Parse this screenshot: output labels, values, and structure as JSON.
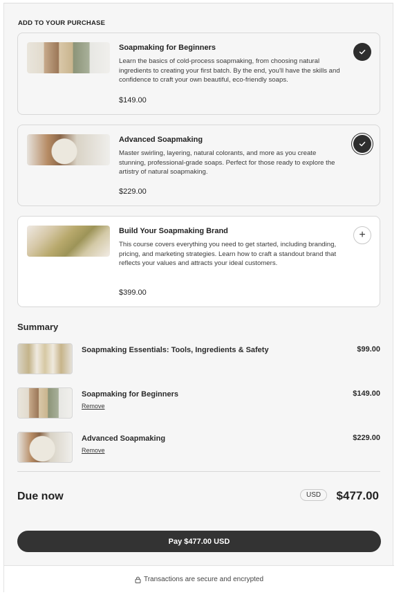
{
  "upsell": {
    "heading": "ADD TO YOUR PURCHASE",
    "items": [
      {
        "title": "Soapmaking for Beginners",
        "description": "Learn the basics of cold-process soapmaking, from choosing natural ingredients to creating your first batch. By the end, you'll have the skills and confidence to craft your own beautiful, eco-friendly soaps.",
        "price": "$149.00",
        "selected": true,
        "icon": "check-icon"
      },
      {
        "title": "Advanced Soapmaking",
        "description": "Master swirling, layering, natural colorants, and more as you create stunning, professional-grade soaps. Perfect for those ready to explore the artistry of natural soapmaking.",
        "price": "$229.00",
        "selected": true,
        "icon": "check-icon"
      },
      {
        "title": "Build Your Soapmaking Brand",
        "description": "This course covers everything you need to get started, including branding, pricing, and marketing strategies. Learn how to craft a standout brand that reflects your values and attracts your ideal customers.",
        "price": "$399.00",
        "selected": false,
        "icon": "plus-icon",
        "action_glyph": "+"
      }
    ]
  },
  "summary": {
    "heading": "Summary",
    "rows": [
      {
        "name": "Soapmaking Essentials: Tools, Ingredients & Safety",
        "amount": "$99.00",
        "removable": false
      },
      {
        "name": "Soapmaking for Beginners",
        "amount": "$149.00",
        "removable": true,
        "remove_label": "Remove"
      },
      {
        "name": "Advanced Soapmaking",
        "amount": "$229.00",
        "removable": true,
        "remove_label": "Remove"
      }
    ]
  },
  "due": {
    "label": "Due now",
    "currency": "USD",
    "total": "$477.00"
  },
  "pay_button": {
    "label": "Pay $477.00 USD"
  },
  "footer": {
    "text": "Transactions are secure and encrypted",
    "icon": "lock-icon"
  },
  "colors": {
    "button": "#333333",
    "panel": "#f6f6f6",
    "border": "#d8d8d8"
  }
}
